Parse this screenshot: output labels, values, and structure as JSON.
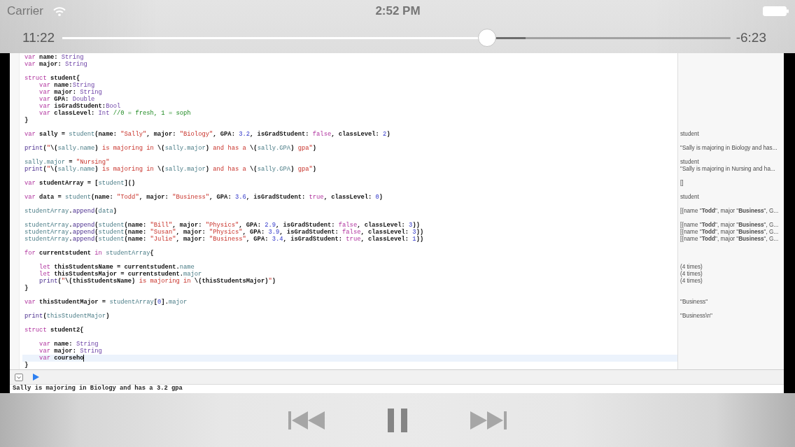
{
  "status_bar": {
    "carrier": "Carrier",
    "time": "2:52 PM"
  },
  "scrubber": {
    "elapsed": "11:22",
    "level": 0.636,
    "buffered": {
      "level": 0.693
    },
    "remaining": "-6:23"
  },
  "video": {
    "editor": {
      "lines": [
        {
          "kind": "code",
          "current": false,
          "tokens": [
            {
              "kind": "keyword",
              "text": "var"
            },
            {
              "kind": "plain",
              "text": " name: "
            },
            {
              "kind": "type",
              "text": "String"
            }
          ]
        },
        {
          "kind": "code",
          "current": false,
          "tokens": [
            {
              "kind": "keyword",
              "text": "var"
            },
            {
              "kind": "plain",
              "text": " major: "
            },
            {
              "kind": "type",
              "text": "String"
            }
          ]
        },
        {
          "kind": "blank",
          "current": false
        },
        {
          "kind": "code",
          "current": false,
          "tokens": [
            {
              "kind": "keyword",
              "text": "struct"
            },
            {
              "kind": "plain",
              "text": " student{"
            }
          ],
          "children": [
            {
              "kind": "code",
              "current": false,
              "tokens": [
                {
                  "kind": "keyword",
                  "text": "var"
                },
                {
                  "kind": "plain",
                  "text": " name:"
                },
                {
                  "kind": "type",
                  "text": "String"
                }
              ]
            },
            {
              "kind": "code",
              "current": false,
              "tokens": [
                {
                  "kind": "keyword",
                  "text": "var"
                },
                {
                  "kind": "plain",
                  "text": " major: "
                },
                {
                  "kind": "type",
                  "text": "String"
                }
              ]
            },
            {
              "kind": "code",
              "current": false,
              "tokens": [
                {
                  "kind": "keyword",
                  "text": "var"
                },
                {
                  "kind": "plain",
                  "text": " GPA: "
                },
                {
                  "kind": "type",
                  "text": "Double"
                }
              ]
            },
            {
              "kind": "code",
              "current": false,
              "tokens": [
                {
                  "kind": "keyword",
                  "text": "var"
                },
                {
                  "kind": "plain",
                  "text": " isGradStudent:"
                },
                {
                  "kind": "type",
                  "text": "Bool"
                }
              ]
            },
            {
              "kind": "code",
              "current": false,
              "tokens": [
                {
                  "kind": "keyword",
                  "text": "var"
                },
                {
                  "kind": "plain",
                  "text": " classLevel: "
                },
                {
                  "kind": "type",
                  "text": "Int"
                },
                {
                  "kind": "comment",
                  "text": " //0 = fresh, 1 = soph"
                }
              ]
            }
          ]
        },
        {
          "kind": "code",
          "current": false,
          "tokens": [
            {
              "kind": "plain",
              "text": "}"
            }
          ]
        },
        {
          "kind": "blank",
          "current": false
        },
        {
          "kind": "code",
          "current": false,
          "result": "student",
          "tokens": [
            {
              "kind": "keyword",
              "text": "var"
            },
            {
              "kind": "plain",
              "text": " sally = "
            },
            {
              "kind": "project",
              "text": "student"
            },
            {
              "kind": "plain",
              "text": "(name: "
            },
            {
              "kind": "string",
              "text": "\"Sally\""
            },
            {
              "kind": "plain",
              "text": ", major: "
            },
            {
              "kind": "string",
              "text": "\"Biology\""
            },
            {
              "kind": "plain",
              "text": ", GPA: "
            },
            {
              "kind": "number",
              "text": "3.2"
            },
            {
              "kind": "plain",
              "text": ", isGradStudent: "
            },
            {
              "kind": "keyword",
              "text": "false"
            },
            {
              "kind": "plain",
              "text": ", classLevel: "
            },
            {
              "kind": "number",
              "text": "2"
            },
            {
              "kind": "plain",
              "text": ")"
            }
          ]
        },
        {
          "kind": "blank",
          "current": false
        },
        {
          "kind": "code",
          "current": false,
          "result": "\"Sally is majoring in Biology and has...",
          "tokens": [
            {
              "kind": "library",
              "text": "print"
            },
            {
              "kind": "plain",
              "text": "("
            },
            {
              "kind": "string",
              "text": "\""
            },
            {
              "kind": "plain",
              "text": "\\("
            },
            {
              "kind": "project",
              "text": "sally.name"
            },
            {
              "kind": "plain",
              "text": ")"
            },
            {
              "kind": "string",
              "text": " is majoring in "
            },
            {
              "kind": "plain",
              "text": "\\("
            },
            {
              "kind": "project",
              "text": "sally.major"
            },
            {
              "kind": "plain",
              "text": ")"
            },
            {
              "kind": "string",
              "text": " and has a "
            },
            {
              "kind": "plain",
              "text": "\\("
            },
            {
              "kind": "project",
              "text": "sally.GPA"
            },
            {
              "kind": "plain",
              "text": ")"
            },
            {
              "kind": "string",
              "text": " gpa\""
            },
            {
              "kind": "plain",
              "text": ")"
            }
          ]
        },
        {
          "kind": "blank",
          "current": false
        },
        {
          "kind": "code",
          "current": false,
          "result": "student",
          "tokens": [
            {
              "kind": "project",
              "text": "sally.major"
            },
            {
              "kind": "plain",
              "text": " = "
            },
            {
              "kind": "string",
              "text": "\"Nursing\""
            }
          ]
        },
        {
          "kind": "code",
          "current": false,
          "result": "\"Sally is majoring in Nursing and ha...",
          "tokens": [
            {
              "kind": "library",
              "text": "print"
            },
            {
              "kind": "plain",
              "text": "("
            },
            {
              "kind": "string",
              "text": "\""
            },
            {
              "kind": "plain",
              "text": "\\("
            },
            {
              "kind": "project",
              "text": "sally.name"
            },
            {
              "kind": "plain",
              "text": ")"
            },
            {
              "kind": "string",
              "text": " is majoring in "
            },
            {
              "kind": "plain",
              "text": "\\("
            },
            {
              "kind": "project",
              "text": "sally.major"
            },
            {
              "kind": "plain",
              "text": ")"
            },
            {
              "kind": "string",
              "text": " and has a "
            },
            {
              "kind": "plain",
              "text": "\\("
            },
            {
              "kind": "project",
              "text": "sally.GPA"
            },
            {
              "kind": "plain",
              "text": ")"
            },
            {
              "kind": "string",
              "text": " gpa\""
            },
            {
              "kind": "plain",
              "text": ")"
            }
          ]
        },
        {
          "kind": "blank",
          "current": false
        },
        {
          "kind": "code",
          "current": false,
          "result": "[]",
          "tokens": [
            {
              "kind": "keyword",
              "text": "var"
            },
            {
              "kind": "plain",
              "text": " studentArray = ["
            },
            {
              "kind": "project",
              "text": "student"
            },
            {
              "kind": "plain",
              "text": "]()"
            }
          ]
        },
        {
          "kind": "blank",
          "current": false
        },
        {
          "kind": "code",
          "current": false,
          "result": "student",
          "tokens": [
            {
              "kind": "keyword",
              "text": "var"
            },
            {
              "kind": "plain",
              "text": " data = "
            },
            {
              "kind": "project",
              "text": "student"
            },
            {
              "kind": "plain",
              "text": "(name: "
            },
            {
              "kind": "string",
              "text": "\"Todd\""
            },
            {
              "kind": "plain",
              "text": ", major: "
            },
            {
              "kind": "string",
              "text": "\"Business\""
            },
            {
              "kind": "plain",
              "text": ", GPA: "
            },
            {
              "kind": "number",
              "text": "3.6"
            },
            {
              "kind": "plain",
              "text": ", isGradStudent: "
            },
            {
              "kind": "keyword",
              "text": "true"
            },
            {
              "kind": "plain",
              "text": ", classLevel: "
            },
            {
              "kind": "number",
              "text": "0"
            },
            {
              "kind": "plain",
              "text": ")"
            }
          ]
        },
        {
          "kind": "blank",
          "current": false
        },
        {
          "kind": "code",
          "current": false,
          "result": "[{name \"**Todd**\", major \"**Business**\", G...",
          "tokens": [
            {
              "kind": "project",
              "text": "studentArray"
            },
            {
              "kind": "plain",
              "text": "."
            },
            {
              "kind": "library",
              "text": "append"
            },
            {
              "kind": "plain",
              "text": "("
            },
            {
              "kind": "project",
              "text": "data"
            },
            {
              "kind": "plain",
              "text": ")"
            }
          ]
        },
        {
          "kind": "blank",
          "current": false
        },
        {
          "kind": "code",
          "current": false,
          "result": "[{name \"**Todd**\", major \"**Business**\", G...",
          "tokens": [
            {
              "kind": "project",
              "text": "studentArray"
            },
            {
              "kind": "plain",
              "text": "."
            },
            {
              "kind": "library",
              "text": "append"
            },
            {
              "kind": "plain",
              "text": "("
            },
            {
              "kind": "project",
              "text": "student"
            },
            {
              "kind": "plain",
              "text": "(name: "
            },
            {
              "kind": "string",
              "text": "\"Bill\""
            },
            {
              "kind": "plain",
              "text": ", major: "
            },
            {
              "kind": "string",
              "text": "\"Physics\""
            },
            {
              "kind": "plain",
              "text": ", GPA: "
            },
            {
              "kind": "number",
              "text": "2.9"
            },
            {
              "kind": "plain",
              "text": ", isGradStudent: "
            },
            {
              "kind": "keyword",
              "text": "false"
            },
            {
              "kind": "plain",
              "text": ", classLevel: "
            },
            {
              "kind": "number",
              "text": "3"
            },
            {
              "kind": "plain",
              "text": "))"
            }
          ]
        },
        {
          "kind": "code",
          "current": false,
          "result": "[{name \"**Todd**\", major \"**Business**\", G...",
          "tokens": [
            {
              "kind": "project",
              "text": "studentArray"
            },
            {
              "kind": "plain",
              "text": "."
            },
            {
              "kind": "library",
              "text": "append"
            },
            {
              "kind": "plain",
              "text": "("
            },
            {
              "kind": "project",
              "text": "student"
            },
            {
              "kind": "plain",
              "text": "(name: "
            },
            {
              "kind": "string",
              "text": "\"Susan\""
            },
            {
              "kind": "plain",
              "text": ", major: "
            },
            {
              "kind": "string",
              "text": "\"Physics\""
            },
            {
              "kind": "plain",
              "text": ", GPA: "
            },
            {
              "kind": "number",
              "text": "3.9"
            },
            {
              "kind": "plain",
              "text": ", isGradStudent: "
            },
            {
              "kind": "keyword",
              "text": "false"
            },
            {
              "kind": "plain",
              "text": ", classLevel: "
            },
            {
              "kind": "number",
              "text": "3"
            },
            {
              "kind": "plain",
              "text": "))"
            }
          ]
        },
        {
          "kind": "code",
          "current": false,
          "result": "[{name \"**Todd**\", major \"**Business**\", G...",
          "tokens": [
            {
              "kind": "project",
              "text": "studentArray"
            },
            {
              "kind": "plain",
              "text": "."
            },
            {
              "kind": "library",
              "text": "append"
            },
            {
              "kind": "plain",
              "text": "("
            },
            {
              "kind": "project",
              "text": "student"
            },
            {
              "kind": "plain",
              "text": "(name: "
            },
            {
              "kind": "string",
              "text": "\"Julie\""
            },
            {
              "kind": "plain",
              "text": ", major: "
            },
            {
              "kind": "string",
              "text": "\"Business\""
            },
            {
              "kind": "plain",
              "text": ", GPA: "
            },
            {
              "kind": "number",
              "text": "3.4"
            },
            {
              "kind": "plain",
              "text": ", isGradStudent: "
            },
            {
              "kind": "keyword",
              "text": "true"
            },
            {
              "kind": "plain",
              "text": ", classLevel: "
            },
            {
              "kind": "number",
              "text": "1"
            },
            {
              "kind": "plain",
              "text": "))"
            }
          ]
        },
        {
          "kind": "blank",
          "current": false
        },
        {
          "kind": "code",
          "current": false,
          "tokens": [
            {
              "kind": "keyword",
              "text": "for"
            },
            {
              "kind": "plain",
              "text": " currentstudent "
            },
            {
              "kind": "keyword",
              "text": "in"
            },
            {
              "kind": "project",
              "text": " studentArray"
            },
            {
              "kind": "plain",
              "text": "{"
            }
          ],
          "children": [
            {
              "kind": "blank",
              "current": false
            },
            {
              "kind": "code",
              "current": false,
              "result": "(4 times)",
              "tokens": [
                {
                  "kind": "keyword",
                  "text": "let"
                },
                {
                  "kind": "plain",
                  "text": " thisStudentsName = currentstudent."
                },
                {
                  "kind": "project",
                  "text": "name"
                }
              ]
            },
            {
              "kind": "code",
              "current": false,
              "result": "(4 times)",
              "tokens": [
                {
                  "kind": "keyword",
                  "text": "let"
                },
                {
                  "kind": "plain",
                  "text": " thisStudentsMajor = currentstudent."
                },
                {
                  "kind": "project",
                  "text": "major"
                }
              ]
            },
            {
              "kind": "code",
              "current": false,
              "result": "(4 times)",
              "tokens": [
                {
                  "kind": "library",
                  "text": "print"
                },
                {
                  "kind": "plain",
                  "text": "("
                },
                {
                  "kind": "string",
                  "text": "\""
                },
                {
                  "kind": "plain",
                  "text": "\\(thisStudentsName)"
                },
                {
                  "kind": "string",
                  "text": " is majoring in "
                },
                {
                  "kind": "plain",
                  "text": "\\(thisStudentsMajor)"
                },
                {
                  "kind": "string",
                  "text": "\""
                },
                {
                  "kind": "plain",
                  "text": ")"
                }
              ]
            }
          ]
        },
        {
          "kind": "code",
          "current": false,
          "tokens": [
            {
              "kind": "plain",
              "text": "}"
            }
          ]
        },
        {
          "kind": "blank",
          "current": false
        },
        {
          "kind": "code",
          "current": false,
          "result": "\"Business\"",
          "tokens": [
            {
              "kind": "keyword",
              "text": "var"
            },
            {
              "kind": "plain",
              "text": " thisStudentMajor = "
            },
            {
              "kind": "project",
              "text": "studentArray"
            },
            {
              "kind": "plain",
              "text": "["
            },
            {
              "kind": "number",
              "text": "0"
            },
            {
              "kind": "plain",
              "text": "]."
            },
            {
              "kind": "project",
              "text": "major"
            }
          ]
        },
        {
          "kind": "blank",
          "current": false
        },
        {
          "kind": "code",
          "current": false,
          "result": "\"Business\\n\"",
          "tokens": [
            {
              "kind": "library",
              "text": "print"
            },
            {
              "kind": "plain",
              "text": "("
            },
            {
              "kind": "project",
              "text": "thisStudentMajor"
            },
            {
              "kind": "plain",
              "text": ")"
            }
          ]
        },
        {
          "kind": "blank",
          "current": false
        },
        {
          "kind": "code",
          "current": false,
          "tokens": [
            {
              "kind": "keyword",
              "text": "struct"
            },
            {
              "kind": "plain",
              "text": " student2{"
            }
          ],
          "children": [
            {
              "kind": "blank",
              "current": false
            },
            {
              "kind": "code",
              "current": false,
              "tokens": [
                {
                  "kind": "keyword",
                  "text": "var"
                },
                {
                  "kind": "plain",
                  "text": " name: "
                },
                {
                  "kind": "type",
                  "text": "String"
                }
              ]
            },
            {
              "kind": "code",
              "current": false,
              "tokens": [
                {
                  "kind": "keyword",
                  "text": "var"
                },
                {
                  "kind": "plain",
                  "text": " major: "
                },
                {
                  "kind": "type",
                  "text": "String"
                }
              ]
            },
            {
              "kind": "code",
              "current": true,
              "tokens": [
                {
                  "kind": "keyword",
                  "text": "var"
                },
                {
                  "kind": "plain",
                  "text": " courseho"
                }
              ]
            }
          ]
        },
        {
          "kind": "code",
          "current": false,
          "tokens": [
            {
              "kind": "plain",
              "text": "}"
            }
          ]
        }
      ]
    },
    "console": {
      "output": "Sally is majoring in Biology and has a 3.2 gpa"
    }
  },
  "transport": {
    "playing": true
  }
}
